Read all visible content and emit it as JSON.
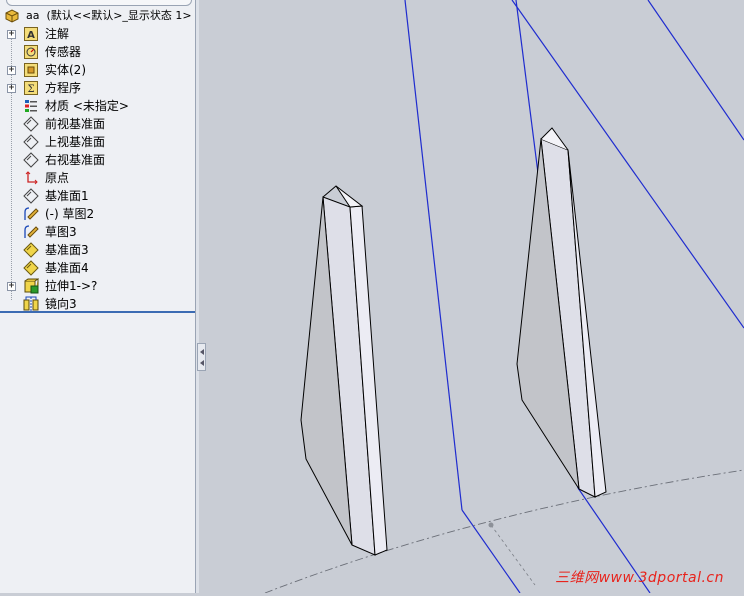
{
  "feature_tree": {
    "root": {
      "part_name": "aa",
      "config": "(默认<<默认>_显示状态 1>"
    },
    "items": [
      {
        "label": "注解",
        "icon": "annotation-icon",
        "expandable": true
      },
      {
        "label": "传感器",
        "icon": "sensor-icon",
        "expandable": false
      },
      {
        "label": "实体(2)",
        "icon": "solid-bodies-folder-icon",
        "expandable": true
      },
      {
        "label": "方程序",
        "icon": "equations-icon",
        "expandable": true
      },
      {
        "label": "材质 <未指定>",
        "icon": "material-icon",
        "expandable": false
      },
      {
        "label": "前视基准面",
        "icon": "plane-icon",
        "expandable": false
      },
      {
        "label": "上视基准面",
        "icon": "plane-icon",
        "expandable": false
      },
      {
        "label": "右视基准面",
        "icon": "plane-icon",
        "expandable": false
      },
      {
        "label": "原点",
        "icon": "origin-icon",
        "expandable": false
      },
      {
        "label": "基准面1",
        "icon": "plane-icon",
        "expandable": false
      },
      {
        "label": "(-) 草图2",
        "icon": "sketch-icon",
        "expandable": false
      },
      {
        "label": "草图3",
        "icon": "sketch-icon",
        "expandable": false
      },
      {
        "label": "基准面3",
        "icon": "plane-yellow-icon",
        "expandable": false
      },
      {
        "label": "基准面4",
        "icon": "plane-yellow-icon",
        "expandable": false
      },
      {
        "label": "拉伸1->?",
        "icon": "extrude-icon",
        "expandable": true
      },
      {
        "label": "镜向3",
        "icon": "mirror-icon",
        "expandable": false
      }
    ]
  },
  "viewport": {
    "background_color": "#c9cdd5",
    "edge_color": "#1f2ccf",
    "watermark": "三维网www.3dportal.cn"
  }
}
